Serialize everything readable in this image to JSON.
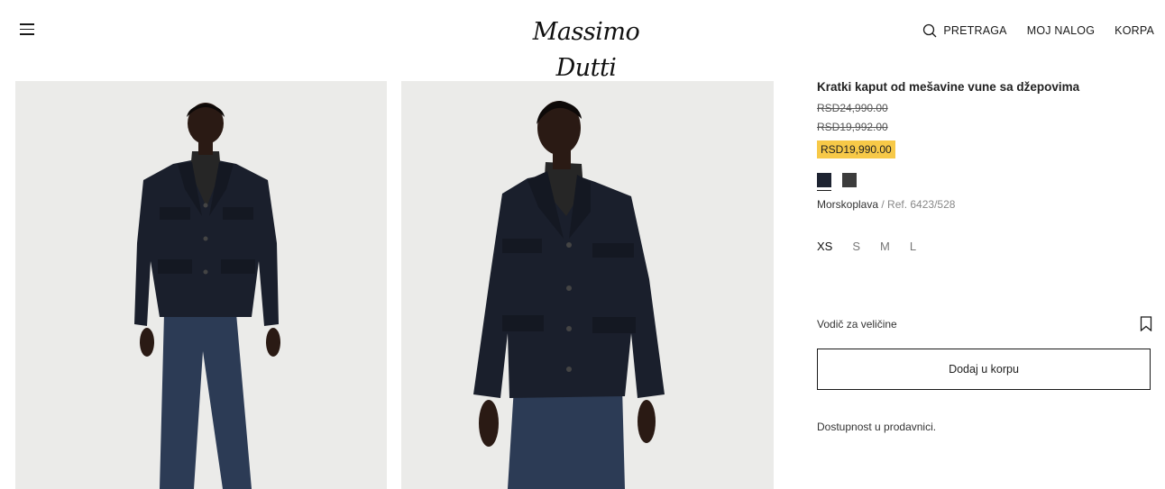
{
  "header": {
    "logo_text": "Massimo Dutti",
    "search_label": "PRETRAGA",
    "account_label": "MOJ NALOG",
    "cart_label": "KORPA",
    "icons": [
      "menu-icon",
      "search-icon"
    ]
  },
  "product": {
    "title": "Kratki kaput od mešavine vune sa džepovima",
    "original_price": "RSD24,990.00",
    "previous_price": "RSD19,992.00",
    "sale_price": "RSD19,990.00",
    "sale_badge_color": "#f7c948",
    "colors": [
      {
        "name": "navy",
        "hex": "#1d2331",
        "selected": true
      },
      {
        "name": "charcoal",
        "hex": "#3c3c3c",
        "selected": false
      }
    ],
    "color_name": "Morskoplava",
    "ref_text": "/ Ref. 6423/528",
    "sizes": [
      "XS",
      "S",
      "M",
      "L"
    ],
    "selected_size": "XS",
    "size_guide_label": "Vodič za veličine",
    "add_to_cart_label": "Dodaj u korpu",
    "store_availability_label": "Dostupnost u prodavnici."
  },
  "gallery": {
    "images": [
      "model-front-photo",
      "model-three-quarter-photo"
    ],
    "background": "#ebebe9",
    "coat_color": "#1a1f2c",
    "jeans_color": "#2c3b55"
  }
}
